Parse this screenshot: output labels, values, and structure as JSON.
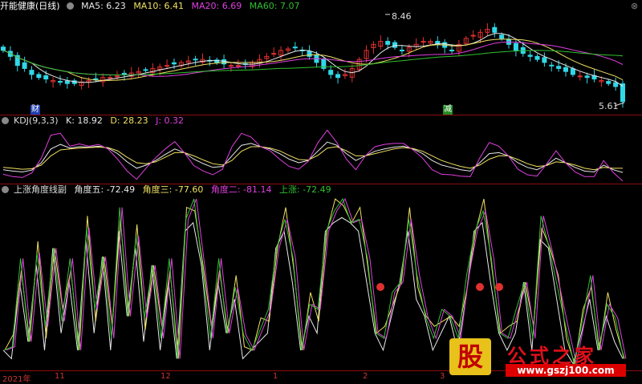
{
  "main_legend": {
    "title": "开能健康(日线)",
    "ma5": "MA5: 6.23",
    "ma10": "MA10: 6.41",
    "ma20": "MA20: 6.69",
    "ma60": "MA60: 7.07",
    "colors": {
      "ma5": "#e8e8e8",
      "ma10": "#f0e060",
      "ma20": "#e040e0",
      "ma60": "#30c030"
    }
  },
  "kdj_legend": {
    "title": "KDJ(9,3,3)",
    "k": "K: 18.92",
    "d": "D: 28.23",
    "j": "J: 0.32",
    "colors": {
      "k": "#e8e8e8",
      "d": "#f0e060",
      "j": "#e040e0"
    }
  },
  "angle_legend": {
    "title": "上涨角度线副",
    "a5": "角度五: -72.49",
    "a3": "角度三: -77.60",
    "a2": "角度二: -81.14",
    "up": "上涨: -72.49",
    "colors": {
      "a5": "#e8e8e8",
      "a3": "#f0e060",
      "a2": "#e040e0",
      "up": "#30c030"
    }
  },
  "annotations": {
    "high": "8.46",
    "low": "5.61",
    "fin1": "财",
    "fin2": "减"
  },
  "x_axis": [
    "2021年",
    "11",
    "12",
    "1",
    "2",
    "3"
  ],
  "watermark": {
    "logo": "股",
    "text": "公式之家",
    "url": "www.gszj100.com"
  },
  "chart_data": [
    {
      "type": "candlestick",
      "title": "开能健康(日线)",
      "x": [
        "2021年",
        "11",
        "12",
        "1",
        "2",
        "3"
      ],
      "price_high": 8.46,
      "price_low": 5.61,
      "close": [
        7.4,
        7.2,
        6.9,
        6.8,
        6.6,
        6.5,
        6.45,
        6.4,
        6.35,
        6.3,
        6.3,
        6.35,
        6.4,
        6.45,
        6.5,
        6.5,
        6.55,
        6.6,
        6.65,
        6.7,
        6.75,
        6.8,
        6.85,
        6.9,
        6.95,
        7.0,
        7.05,
        7.1,
        7.1,
        7.05,
        7.0,
        6.95,
        6.9,
        6.9,
        6.95,
        7.0,
        7.1,
        7.2,
        7.3,
        7.4,
        7.45,
        7.5,
        7.4,
        7.2,
        7.0,
        6.8,
        6.6,
        6.5,
        6.6,
        6.8,
        7.1,
        7.4,
        7.6,
        7.7,
        7.6,
        7.5,
        7.4,
        7.5,
        7.6,
        7.7,
        7.7,
        7.6,
        7.5,
        7.4,
        7.6,
        7.8,
        7.9,
        8.0,
        8.1,
        8.0,
        7.8,
        7.6,
        7.4,
        7.3,
        7.2,
        7.1,
        7.0,
        6.9,
        6.8,
        6.7,
        6.6,
        6.55,
        6.5,
        6.45,
        6.4,
        6.3,
        6.2,
        5.7
      ],
      "series": [
        {
          "name": "MA5",
          "value": 6.23
        },
        {
          "name": "MA10",
          "value": 6.41
        },
        {
          "name": "MA20",
          "value": 6.69
        },
        {
          "name": "MA60",
          "value": 7.07
        }
      ]
    },
    {
      "type": "line",
      "title": "KDJ(9,3,3)",
      "series": [
        {
          "name": "K",
          "last": 18.92,
          "values": [
            25,
            22,
            20,
            24,
            40,
            70,
            80,
            72,
            75,
            74,
            76,
            72,
            60,
            42,
            28,
            35,
            45,
            58,
            70,
            62,
            48,
            38,
            30,
            32,
            55,
            78,
            82,
            75,
            70,
            60,
            48,
            40,
            45,
            65,
            85,
            78,
            60,
            45,
            55,
            65,
            70,
            74,
            76,
            70,
            60,
            45,
            35,
            30,
            25,
            22,
            40,
            60,
            62,
            55,
            40,
            30,
            25,
            35,
            50,
            40,
            30,
            22,
            20,
            35,
            25,
            19
          ]
        },
        {
          "name": "D",
          "last": 28.23,
          "values": [
            30,
            28,
            26,
            27,
            35,
            55,
            68,
            70,
            72,
            73,
            74,
            73,
            66,
            52,
            40,
            38,
            42,
            52,
            62,
            62,
            55,
            46,
            38,
            35,
            45,
            65,
            75,
            75,
            72,
            66,
            56,
            47,
            46,
            56,
            72,
            75,
            66,
            55,
            55,
            60,
            65,
            70,
            73,
            71,
            65,
            55,
            45,
            38,
            32,
            28,
            35,
            48,
            55,
            55,
            47,
            38,
            32,
            34,
            42,
            40,
            35,
            28,
            25,
            30,
            28,
            28
          ]
        },
        {
          "name": "J",
          "last": 0.32,
          "values": [
            15,
            10,
            8,
            18,
            50,
            100,
            104,
            76,
            81,
            76,
            80,
            70,
            48,
            22,
            4,
            29,
            51,
            70,
            86,
            62,
            34,
            22,
            14,
            26,
            75,
            104,
            96,
            75,
            66,
            48,
            32,
            26,
            43,
            83,
            111,
            84,
            48,
            25,
            55,
            75,
            80,
            82,
            82,
            68,
            50,
            25,
            15,
            14,
            11,
            10,
            50,
            84,
            76,
            55,
            26,
            14,
            11,
            37,
            66,
            40,
            20,
            10,
            10,
            45,
            19,
            0.32
          ]
        }
      ]
    },
    {
      "type": "line",
      "title": "上涨角度线副",
      "series": [
        {
          "name": "角度五",
          "last": -72.49
        },
        {
          "name": "角度三",
          "last": -77.6
        },
        {
          "name": "角度二",
          "last": -81.14
        },
        {
          "name": "上涨",
          "last": -72.49
        }
      ]
    }
  ]
}
